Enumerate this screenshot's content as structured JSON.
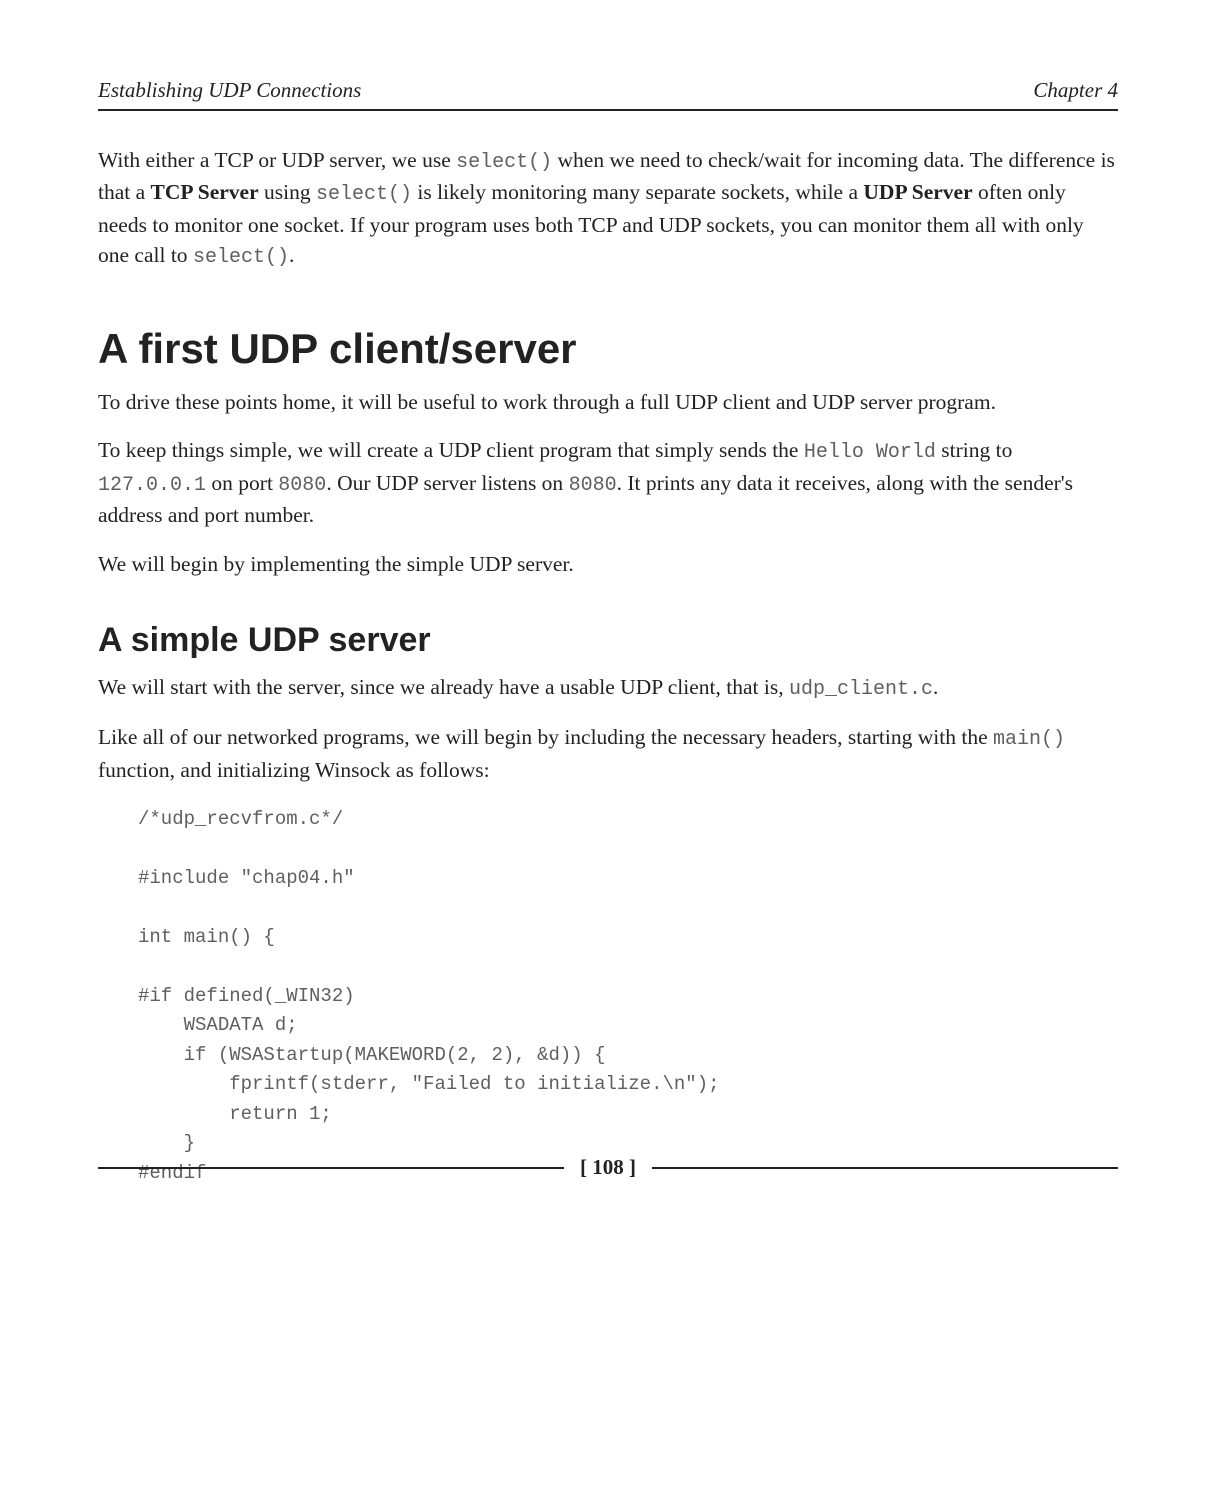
{
  "header": {
    "chapter_title": "Establishing UDP Connections",
    "chapter_label": "Chapter 4"
  },
  "intro": {
    "p1_a": "With either a TCP or UDP server, we use ",
    "p1_code1": "select()",
    "p1_b": " when we need to check/wait for incoming data. The difference is that a ",
    "p1_bold1": "TCP Server",
    "p1_c": " using ",
    "p1_code2": "select()",
    "p1_d": " is likely monitoring many separate sockets, while a ",
    "p1_bold2": "UDP Server",
    "p1_e": " often only needs to monitor one socket. If your program uses both TCP and UDP sockets, you can monitor them all with only one call to ",
    "p1_code3": "select()",
    "p1_f": "."
  },
  "section1": {
    "heading": "A first UDP client/server",
    "p1": "To drive these points home, it will be useful to work through a full UDP client and UDP server program.",
    "p2_a": "To keep things simple, we will create a UDP client program that simply sends the ",
    "p2_code1": "Hello World",
    "p2_b": " string to ",
    "p2_code2": "127.0.0.1",
    "p2_c": " on port ",
    "p2_code3": "8080",
    "p2_d": ". Our UDP server listens on ",
    "p2_code4": "8080",
    "p2_e": ". It prints any data it receives, along with the sender's address and port number.",
    "p3": "We will begin by implementing the simple UDP server."
  },
  "section2": {
    "heading": "A simple UDP server",
    "p1_a": "We will start with the server, since we already have a usable UDP client, that is, ",
    "p1_code1": "udp_client.c",
    "p1_b": ".",
    "p2_a": "Like all of our networked programs, we will begin by including the necessary headers, starting with the ",
    "p2_code1": "main()",
    "p2_b": " function, and initializing Winsock as follows:",
    "code": "/*udp_recvfrom.c*/\n\n#include \"chap04.h\"\n\nint main() {\n\n#if defined(_WIN32)\n    WSADATA d;\n    if (WSAStartup(MAKEWORD(2, 2), &d)) {\n        fprintf(stderr, \"Failed to initialize.\\n\");\n        return 1;\n    }\n#endif"
  },
  "footer": {
    "page": "[ 108 ]"
  }
}
